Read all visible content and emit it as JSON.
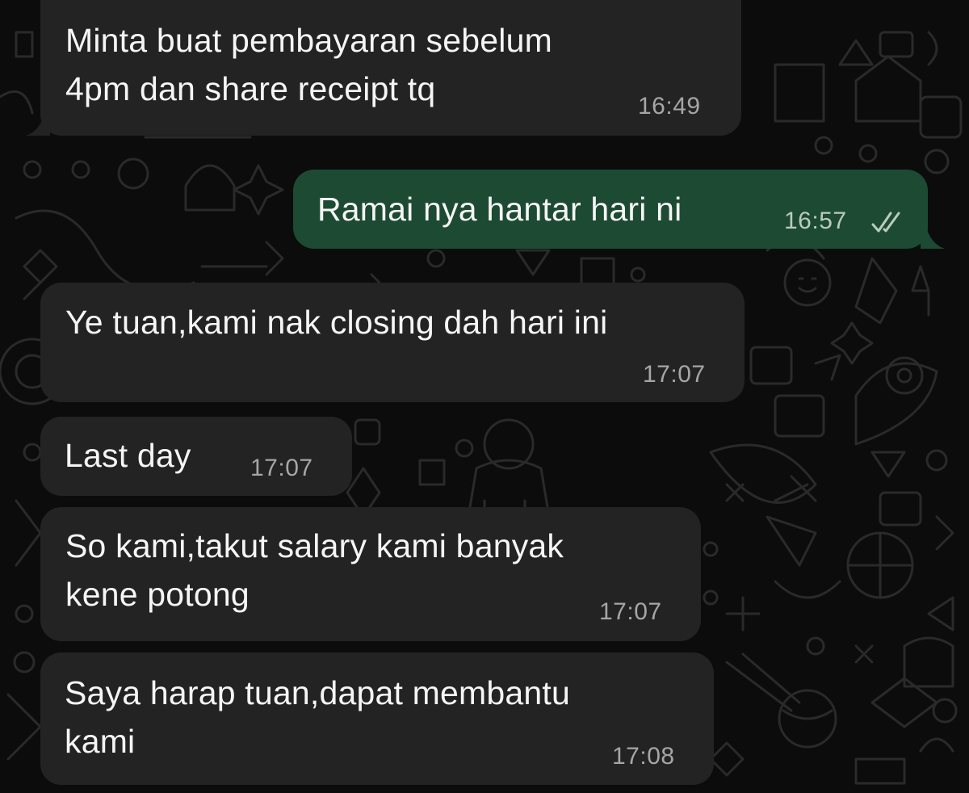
{
  "colors": {
    "background": "#0c0c0c",
    "incoming_bubble": "#232323",
    "outgoing_bubble": "#1d4a33",
    "message_text": "#f5f5f5",
    "timestamp": "#a6a6a6"
  },
  "messages": [
    {
      "direction": "incoming",
      "text": "Minta buat pembayaran sebelum\n4pm dan share receipt tq",
      "time": "16:49"
    },
    {
      "direction": "outgoing",
      "text": "Ramai nya hantar hari ni",
      "time": "16:57",
      "status_icon": "double-check-icon"
    },
    {
      "direction": "incoming",
      "text": "Ye tuan,kami nak closing dah hari ini",
      "time": "17:07"
    },
    {
      "direction": "incoming",
      "text": "Last day",
      "time": "17:07"
    },
    {
      "direction": "incoming",
      "text": "So kami,takut salary kami banyak\nkene potong",
      "time": "17:07"
    },
    {
      "direction": "incoming",
      "text": "Saya harap tuan,dapat membantu\nkami",
      "time": "17:08"
    }
  ]
}
